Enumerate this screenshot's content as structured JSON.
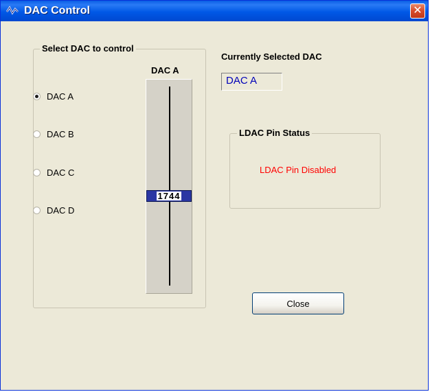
{
  "window": {
    "title": "DAC Control",
    "close_glyph": "✕"
  },
  "dac_select": {
    "group_label": "Select DAC to control",
    "options": [
      {
        "label": "DAC A",
        "selected": true
      },
      {
        "label": "DAC B",
        "selected": false
      },
      {
        "label": "DAC C",
        "selected": false
      },
      {
        "label": "DAC D",
        "selected": false
      }
    ]
  },
  "slider": {
    "label": "DAC A",
    "value": "1744"
  },
  "current": {
    "heading": "Currently Selected DAC",
    "value": "DAC A"
  },
  "ldac": {
    "group_label": "LDAC Pin Status",
    "status": "LDAC Pin Disabled"
  },
  "buttons": {
    "close_label": "Close"
  },
  "colors": {
    "title_bar": "#0058e6",
    "client_bg": "#ece9d8",
    "selected_text": "#0000b8",
    "status_text": "#ff0000",
    "close_button": "#d84a2a"
  }
}
